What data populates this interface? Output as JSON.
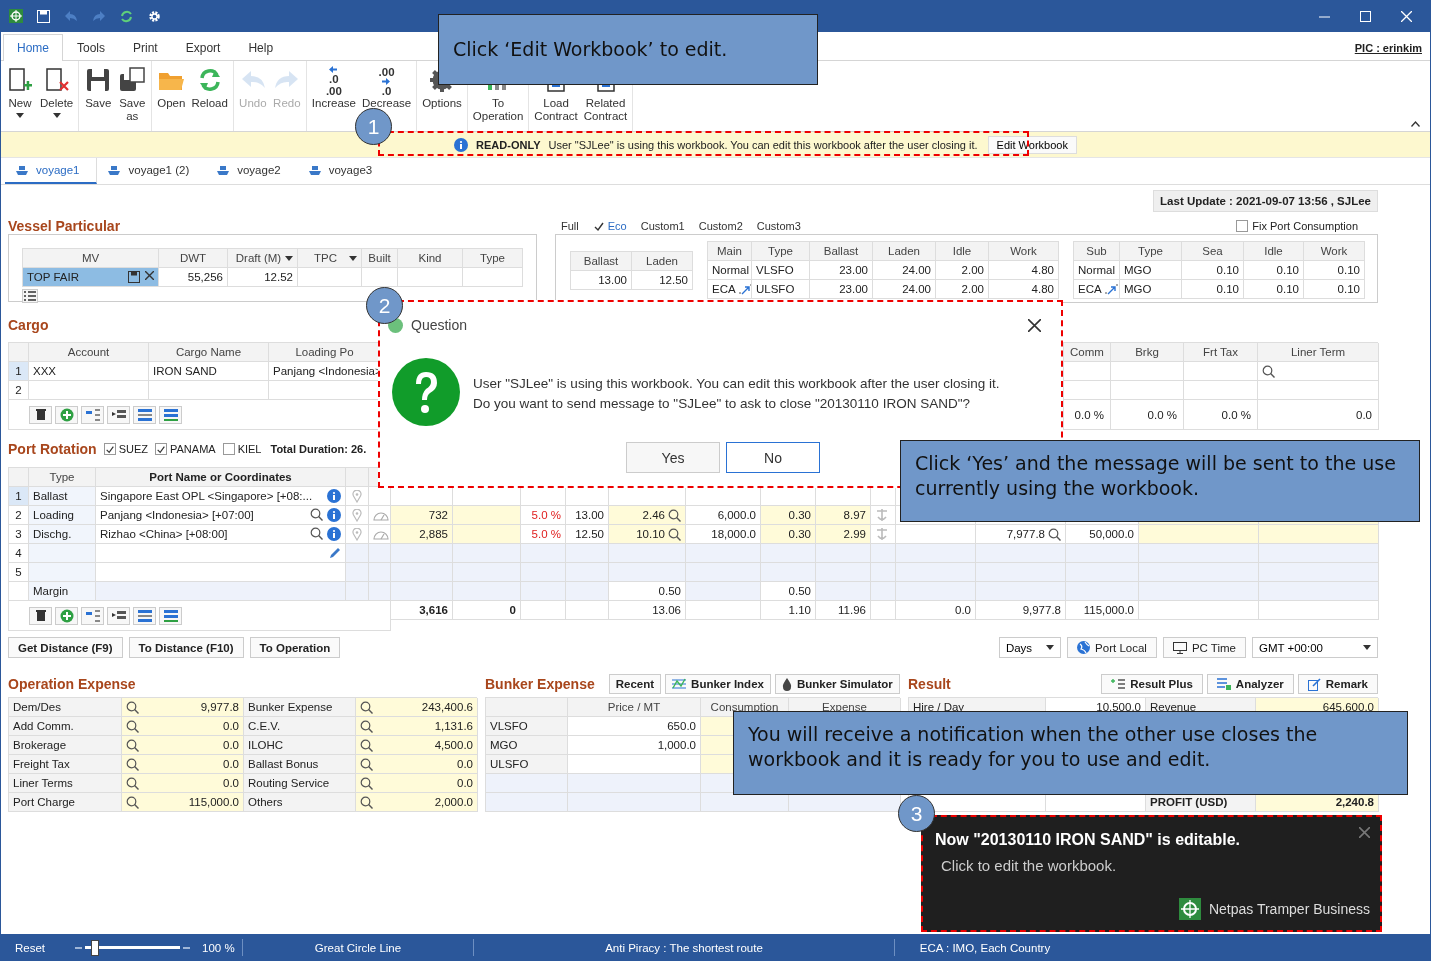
{
  "menu": {
    "tabs": [
      {
        "label": "Home",
        "selected": true
      },
      {
        "label": "Tools",
        "selected": false
      },
      {
        "label": "Print",
        "selected": false
      },
      {
        "label": "Export",
        "selected": false
      },
      {
        "label": "Help",
        "selected": false
      }
    ],
    "user": "PIC : erinkim"
  },
  "ribbon": {
    "groups": [
      [
        {
          "label": "New",
          "dropdown": true,
          "disabled": false
        },
        {
          "label": "Delete",
          "dropdown": true,
          "disabled": false
        }
      ],
      [
        {
          "label": "Save",
          "dropdown": false,
          "disabled": false
        },
        {
          "label": "Save as",
          "dropdown": false,
          "disabled": false
        }
      ],
      [
        {
          "label": "Open",
          "dropdown": false,
          "disabled": false
        },
        {
          "label": "Reload",
          "dropdown": false,
          "disabled": false
        }
      ],
      [
        {
          "label": "Undo",
          "dropdown": false,
          "disabled": true
        },
        {
          "label": "Redo",
          "dropdown": false,
          "disabled": true
        }
      ],
      [
        {
          "label": "Increase",
          "dropdown": false,
          "disabled": false,
          "glyph": [
            ".0",
            ".00"
          ]
        },
        {
          "label": "Decrease",
          "dropdown": false,
          "disabled": false,
          "glyph": [
            ".00",
            ".0"
          ]
        }
      ],
      [
        {
          "label": "Options",
          "dropdown": false,
          "disabled": false
        }
      ],
      [
        {
          "label": "To Operation",
          "dropdown": false,
          "disabled": false
        }
      ],
      [
        {
          "label": "Load Contract",
          "dropdown": false,
          "disabled": false
        },
        {
          "label": "Related Contract",
          "dropdown": false,
          "disabled": false
        }
      ]
    ]
  },
  "notice": {
    "badge": "READ-ONLY",
    "message": "User \"SJLee\" is using this workbook. You can edit this workbook after the user closing it.",
    "button": "Edit Workbook"
  },
  "doc_tabs": [
    {
      "label": "voyage1",
      "selected": true
    },
    {
      "label": "voyage1 (2)",
      "selected": false
    },
    {
      "label": "voyage2",
      "selected": false
    },
    {
      "label": "voyage3",
      "selected": false
    }
  ],
  "last_update": "Last Update : 2021-09-07 13:56 , SJLee",
  "vessel": {
    "title": "Vessel Particular",
    "columns": [
      {
        "label": "MV",
        "dropdown": false
      },
      {
        "label": "DWT",
        "dropdown": false
      },
      {
        "label": "Draft (M)",
        "dropdown": true
      },
      {
        "label": "TPC",
        "dropdown": true
      },
      {
        "label": "Built",
        "dropdown": false
      },
      {
        "label": "Kind",
        "dropdown": false
      },
      {
        "label": "Type",
        "dropdown": false
      }
    ],
    "row": {
      "name": "TOP FAIR",
      "selected": true,
      "dwt": "55,256",
      "draft": "12.52"
    }
  },
  "consumption": {
    "tabs": [
      {
        "label": "Full",
        "selected": false
      },
      {
        "label": "Eco",
        "selected": true
      },
      {
        "label": "Custom1",
        "selected": false
      },
      {
        "label": "Custom2",
        "selected": false
      },
      {
        "label": "Custom3",
        "selected": false
      }
    ],
    "fix_port": {
      "label": "Fix Port Consumption",
      "checked": false
    },
    "speed": {
      "columns": [
        "Ballast",
        "Laden"
      ],
      "rows": [
        [
          "13.00",
          "12.50"
        ]
      ]
    },
    "main": {
      "columns": [
        "Main",
        "Type",
        "Ballast",
        "Laden",
        "Idle",
        "Work"
      ],
      "rows": [
        [
          "Normal",
          "VLSFO",
          "23.00",
          "24.00",
          "2.00",
          "4.80"
        ],
        [
          "ECA",
          "ULSFO",
          "23.00",
          "24.00",
          "2.00",
          "4.80"
        ]
      ]
    },
    "sub": {
      "columns": [
        "Sub",
        "Type",
        "Sea",
        "Idle",
        "Work"
      ],
      "rows": [
        [
          "Normal",
          "MGO",
          "0.10",
          "0.10",
          "0.10"
        ],
        [
          "ECA",
          "MGO",
          "0.10",
          "0.10",
          "0.10"
        ]
      ]
    }
  },
  "cargo": {
    "title": "Cargo",
    "left_columns": [
      "Account",
      "Cargo Name",
      "Loading Po"
    ],
    "right_columns": [
      "Comm",
      "Brkg",
      "Frt Tax",
      "Liner Term"
    ],
    "rows": [
      {
        "num": "1",
        "selected": true,
        "cells": [
          "XXX",
          "IRON SAND",
          "Panjang <Indonesia>"
        ]
      },
      {
        "num": "2",
        "selected": false
      }
    ],
    "totals": [
      "0.0 %",
      "0.0 %",
      "0.0 %",
      "0.0"
    ]
  },
  "port_rotation": {
    "title": "Port Rotation",
    "options": [
      {
        "label": "SUEZ",
        "checked": true
      },
      {
        "label": "PANAMA",
        "checked": true
      },
      {
        "label": "KIEL",
        "checked": false
      }
    ],
    "duration": "Total Duration: 26.",
    "columns": [
      "Type",
      "Port Name or Coordinates"
    ],
    "rows": [
      {
        "num": "1",
        "type": "Ballast",
        "port": "Singapore East OPL <Singapore> [+08:...",
        "selected": true
      },
      {
        "num": "2",
        "type": "Loading",
        "port": "Panjang <Indonesia> [+07:00]",
        "selected": false,
        "values": {
          "column_6": "732",
          "column_8": "5.0 %",
          "column_9": "13.00",
          "column_10": "2.46",
          "column_11": "6,000.0",
          "column_12": "0.30",
          "column_13": "8.97"
        }
      },
      {
        "num": "3",
        "type": "Dischg.",
        "port": "Rizhao <China> [+08:00]",
        "selected": false,
        "values": {
          "column_6": "2,885",
          "column_8": "5.0 %",
          "column_9": "12.50",
          "column_10": "10.10",
          "column_11": "18,000.0",
          "column_12": "0.30",
          "column_13": "2.99",
          "column_15": "7,977.8",
          "column_16": "50,000.0"
        }
      },
      {
        "num": "4",
        "selected": false
      },
      {
        "num": "5",
        "selected": false
      }
    ],
    "margin": {
      "label": "Margin",
      "values": {
        "column_10": "0.50",
        "column_12": "0.50"
      }
    },
    "totals": {
      "column_6": "3,616",
      "column_7": "0",
      "column_10": "13.06",
      "column_12": "1.10",
      "column_13": "11.96",
      "column_14": "0.0",
      "column_15": "9,977.8",
      "column_16": "115,000.0"
    }
  },
  "actions": [
    "Get Distance (F9)",
    "To Distance (F10)",
    "To Operation"
  ],
  "time_controls": {
    "unit": "Days",
    "port_local": "Port Local",
    "pc_time": "PC Time",
    "timezone": "GMT +00:00"
  },
  "operation_expense": {
    "title": "Operation Expense",
    "rows": [
      [
        "Dem/Des",
        "9,977.8",
        "Bunker Expense",
        "243,400.6"
      ],
      [
        "Add Comm.",
        "0.0",
        "C.E.V.",
        "1,131.6"
      ],
      [
        "Brokerage",
        "0.0",
        "ILOHC",
        "4,500.0"
      ],
      [
        "Freight Tax",
        "0.0",
        "Ballast Bonus",
        "0.0"
      ],
      [
        "Liner Terms",
        "0.0",
        "Routing Service",
        "0.0"
      ],
      [
        "Port Charge",
        "115,000.0",
        "Others",
        "2,000.0"
      ]
    ]
  },
  "bunker_expense": {
    "title": "Bunker Expense",
    "buttons": [
      "Recent",
      "Bunker Index",
      "Bunker Simulator"
    ],
    "columns": [
      "Price / MT",
      "Consumption",
      "Expense"
    ],
    "rows": [
      [
        "VLSFO",
        "650.0"
      ],
      [
        "MGO",
        "1,000.0"
      ],
      [
        "ULSFO"
      ]
    ]
  },
  "result": {
    "title": "Result",
    "buttons": [
      "Result Plus",
      "Analyzer",
      "Remark"
    ],
    "rows": [
      [
        "Hire / Day",
        "10,500.0",
        "Revenue",
        "645,600.0"
      ]
    ],
    "profit": {
      "label": "PROFIT (USD)",
      "value": "2,240.8"
    }
  },
  "status_bar": {
    "reset": "Reset",
    "zoom": {
      "level": 0.1
    },
    "zoom_text": "100 %",
    "items": [
      "Great Circle Line",
      "Anti Piracy : The shortest route",
      "ECA : IMO, Each Country"
    ]
  },
  "dialog": {
    "title": "Question",
    "lines": [
      "User \"SJLee\" is using this workbook. You can edit this workbook after the user closing it.",
      "Do you want to send message to \"SJLee\" to ask to close \"20130110 IRON SAND\"?"
    ],
    "buttons": [
      {
        "label": "Yes",
        "focused": false
      },
      {
        "label": "No",
        "focused": true
      }
    ]
  },
  "callouts": [
    "Click ‘Edit Workbook’ to edit.",
    "Click ‘Yes’ and the message will be sent to the use currently using the workbook.",
    "You will receive a notification when the other use closes the workbook and it is ready for you to use and edit."
  ],
  "badges": [
    "1",
    "2",
    "3"
  ],
  "toast": {
    "title": "Now \"20130110 IRON SAND\" is editable.",
    "message": "Click to edit the workbook.",
    "app": "Netpas Tramper Business"
  }
}
